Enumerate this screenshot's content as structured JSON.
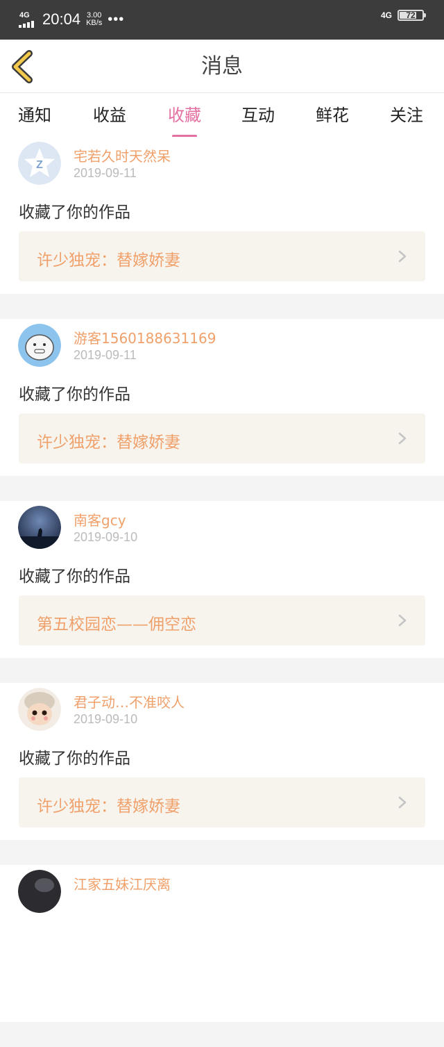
{
  "status_bar": {
    "network_left": "4G",
    "time": "20:04",
    "speed_value": "3.00",
    "speed_unit": "KB/s",
    "more": "•••",
    "network_right": "4G",
    "battery": "72"
  },
  "header": {
    "title": "消息"
  },
  "tabs": [
    {
      "label": "通知",
      "active": false
    },
    {
      "label": "收益",
      "active": false
    },
    {
      "label": "收藏",
      "active": true
    },
    {
      "label": "互动",
      "active": false
    },
    {
      "label": "鲜花",
      "active": false
    },
    {
      "label": "关注",
      "active": false
    }
  ],
  "colors": {
    "accent": "#e46fa1",
    "username": "#f0a06a",
    "work_bg": "#f7f4ee"
  },
  "notifications": [
    {
      "username": "宅若久时天然呆",
      "date": "2019-09-11",
      "action": "收藏了你的作品",
      "work_title": "许少独宠：替嫁娇妻",
      "avatar_icon": "star-avatar-icon"
    },
    {
      "username": "游客1560188631169",
      "date": "2019-09-11",
      "action": "收藏了你的作品",
      "work_title": "许少独宠：替嫁娇妻",
      "avatar_icon": "cartoon-avatar-icon"
    },
    {
      "username": "南客gcy",
      "date": "2019-09-10",
      "action": "收藏了你的作品",
      "work_title": "第五校园恋——佣空恋",
      "avatar_icon": "night-wolf-avatar-icon"
    },
    {
      "username": "君子动…不准咬人",
      "date": "2019-09-10",
      "action": "收藏了你的作品",
      "work_title": "许少独宠：替嫁娇妻",
      "avatar_icon": "doll-avatar-icon"
    },
    {
      "username": "江家五妹江厌离",
      "date": "",
      "action": "",
      "work_title": "",
      "avatar_icon": "dark-avatar-icon"
    }
  ]
}
